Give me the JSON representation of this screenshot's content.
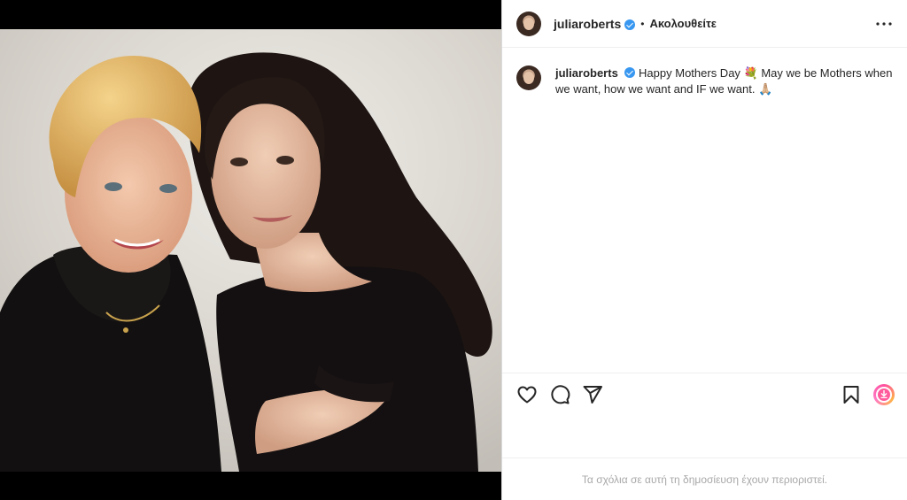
{
  "post": {
    "author": "juliaroberts",
    "follow_status": "Ακολουθείτε",
    "separator": "•",
    "caption_line1": "Happy Mothers Day 💐 May we be Mothers when",
    "caption_line2": "we want, how we want and IF we want. 🙏🏼",
    "comments_disabled": "Τα σχόλια σε αυτή τη δημοσίευση έχουν περιοριστεί."
  },
  "icons": {
    "more": "more-options-icon",
    "like": "heart-icon",
    "comment": "comment-icon",
    "share": "send-icon",
    "save": "bookmark-icon",
    "download": "download-icon"
  },
  "colors": {
    "verified": "#3897f0",
    "muted_text": "#a8a8a8",
    "border": "#dbdbdb"
  }
}
